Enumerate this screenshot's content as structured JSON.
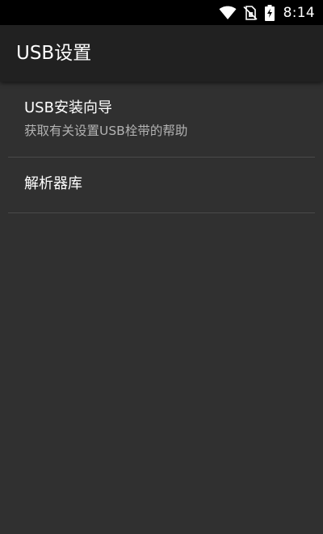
{
  "status_bar": {
    "time": "8:14",
    "icons": [
      "wifi-icon",
      "no-sim-icon",
      "battery-charging-icon"
    ]
  },
  "app_bar": {
    "title": "USB设置"
  },
  "preferences": [
    {
      "title": "USB安装向导",
      "summary": "获取有关设置USB栓带的帮助"
    },
    {
      "title": "解析器库"
    }
  ],
  "colors": {
    "background": "#303030",
    "app_bar": "#212121",
    "status_bar": "#000000",
    "title_text": "#ffffff",
    "summary_text": "#b3b3b3",
    "divider": "#4a4a4a"
  }
}
